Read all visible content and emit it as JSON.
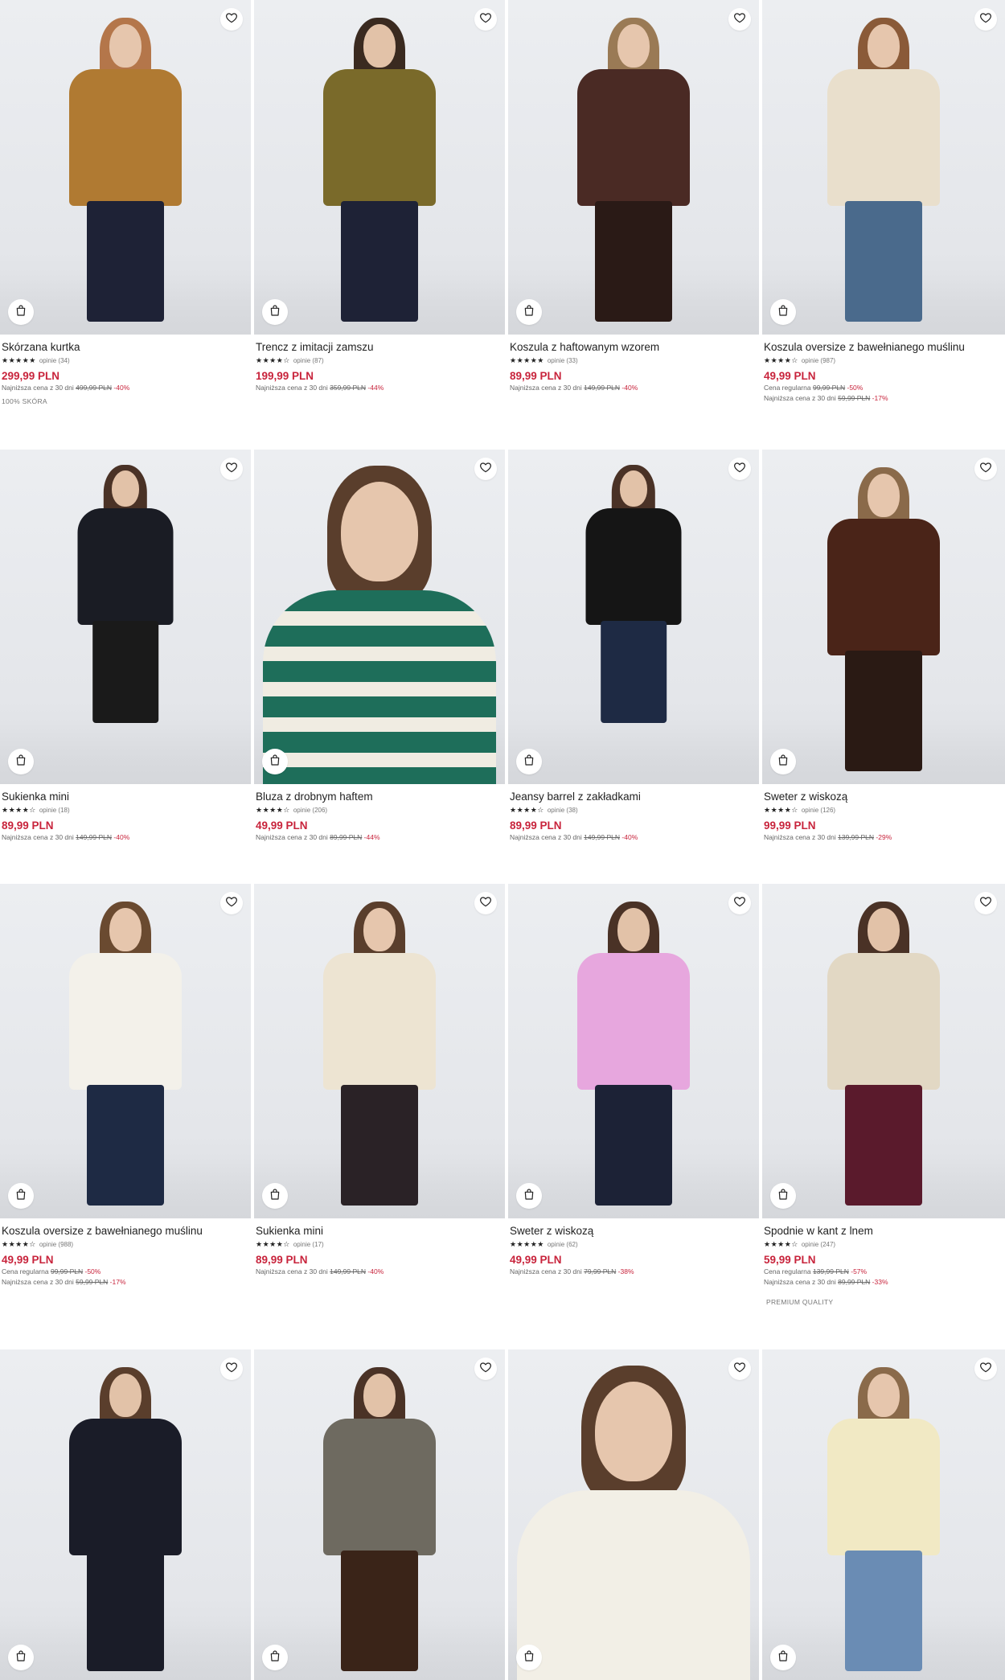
{
  "icons": {
    "wishlist": "heart-icon",
    "add_to_cart": "bag-icon"
  },
  "colors": {
    "price": "#c8243c",
    "text": "#222222",
    "muted": "#666666",
    "image_bg": "#e8eaed"
  },
  "products": [
    {
      "name": "Skórzana kurtka",
      "stars": "★★★★★",
      "reviews": "opinie (34)",
      "price": "299,99 PLN",
      "lines": [
        {
          "label": "Najniższa cena z 30 dni",
          "old": "499,99 PLN",
          "disc": "-40%"
        }
      ],
      "tag": "100% SKÓRA",
      "look": {
        "hair": "#b4764a",
        "top": "#b07a32",
        "bottom": "#1e2236",
        "skin": "#e6c6ad"
      }
    },
    {
      "name": "Trencz z imitacji zamszu",
      "stars": "★★★★☆",
      "reviews": "opinie (87)",
      "price": "199,99 PLN",
      "lines": [
        {
          "label": "Najniższa cena z 30 dni",
          "old": "359,99 PLN",
          "disc": "-44%"
        }
      ],
      "look": {
        "hair": "#3a2a20",
        "top": "#7a6a2a",
        "bottom": "#1e2236",
        "skin": "#e2c2a8"
      }
    },
    {
      "name": "Koszula z haftowanym wzorem",
      "stars": "★★★★★",
      "reviews": "opinie (33)",
      "price": "89,99 PLN",
      "lines": [
        {
          "label": "Najniższa cena z 30 dni",
          "old": "149,99 PLN",
          "disc": "-40%"
        }
      ],
      "look": {
        "hair": "#9a7a55",
        "top": "#4a2a24",
        "bottom": "#2a1a16",
        "skin": "#e6c6ad"
      }
    },
    {
      "name": "Koszula oversize z bawełnianego muślinu",
      "stars": "★★★★☆",
      "reviews": "opinie (987)",
      "price": "49,99 PLN",
      "lines": [
        {
          "label": "Cena regularna",
          "old": "99,99 PLN",
          "disc": "-50%"
        },
        {
          "label": "Najniższa cena z 30 dni",
          "old": "59,99 PLN",
          "disc": "-17%"
        }
      ],
      "look": {
        "hair": "#8a5a38",
        "top": "#e9dfcc",
        "bottom": "#4a6a8c",
        "skin": "#e6c6ad"
      }
    },
    {
      "name": "Sukienka mini",
      "stars": "★★★★☆",
      "reviews": "opinie (18)",
      "price": "89,99 PLN",
      "lines": [
        {
          "label": "Najniższa cena z 30 dni",
          "old": "149,99 PLN",
          "disc": "-40%"
        }
      ],
      "look": {
        "hair": "#4a3226",
        "top": "#1a1c24",
        "bottom": "#1a1a1a",
        "skin": "#e2c2a8"
      }
    },
    {
      "name": "Bluza z drobnym haftem",
      "stars": "★★★★☆",
      "reviews": "opinie (206)",
      "price": "49,99 PLN",
      "lines": [
        {
          "label": "Najniższa cena z 30 dni",
          "old": "89,99 PLN",
          "disc": "-44%"
        }
      ],
      "look": {
        "hair": "#5a3e2c",
        "top": "#1e6e5a",
        "bottom": "#f0ece2",
        "skin": "#e6c6ad"
      }
    },
    {
      "name": "Jeansy barrel z zakładkami",
      "stars": "★★★★☆",
      "reviews": "opinie (38)",
      "price": "89,99 PLN",
      "lines": [
        {
          "label": "Najniższa cena z 30 dni",
          "old": "149,99 PLN",
          "disc": "-40%"
        }
      ],
      "look": {
        "hair": "#4a3226",
        "top": "#151515",
        "bottom": "#1e2a44",
        "skin": "#e2c2a8"
      }
    },
    {
      "name": "Sweter z wiskozą",
      "stars": "★★★★☆",
      "reviews": "opinie (126)",
      "price": "99,99 PLN",
      "lines": [
        {
          "label": "Najniższa cena z 30 dni",
          "old": "139,99 PLN",
          "disc": "-29%"
        }
      ],
      "look": {
        "hair": "#8a6a4a",
        "top": "#4a2418",
        "bottom": "#2a1a14",
        "skin": "#e6c6ad"
      }
    },
    {
      "name": "Koszula oversize z bawełnianego muślinu",
      "stars": "★★★★☆",
      "reviews": "opinie (988)",
      "price": "49,99 PLN",
      "lines": [
        {
          "label": "Cena regularna",
          "old": "99,99 PLN",
          "disc": "-50%"
        },
        {
          "label": "Najniższa cena z 30 dni",
          "old": "59,99 PLN",
          "disc": "-17%"
        }
      ],
      "look": {
        "hair": "#6a4a30",
        "top": "#f3f1ea",
        "bottom": "#1e2a44",
        "skin": "#e6c6ad"
      }
    },
    {
      "name": "Sukienka mini",
      "stars": "★★★★☆",
      "reviews": "opinie (17)",
      "price": "89,99 PLN",
      "lines": [
        {
          "label": "Najniższa cena z 30 dni",
          "old": "149,99 PLN",
          "disc": "-40%"
        }
      ],
      "look": {
        "hair": "#5a3e2c",
        "top": "#ede4d2",
        "bottom": "#2a2226",
        "skin": "#e6c6ad"
      }
    },
    {
      "name": "Sweter z wiskozą",
      "stars": "★★★★★",
      "reviews": "opinie (62)",
      "price": "49,99 PLN",
      "lines": [
        {
          "label": "Najniższa cena z 30 dni",
          "old": "79,99 PLN",
          "disc": "-38%"
        }
      ],
      "look": {
        "hair": "#4a3226",
        "top": "#e7a7de",
        "bottom": "#1c2236",
        "skin": "#e2c2a8"
      }
    },
    {
      "name": "Spodnie w kant z lnem",
      "stars": "★★★★☆",
      "reviews": "opinie (247)",
      "price": "59,99 PLN",
      "lines": [
        {
          "label": "Cena regularna",
          "old": "139,99 PLN",
          "disc": "-57%"
        },
        {
          "label": "Najniższa cena z 30 dni",
          "old": "89,99 PLN",
          "disc": "-33%"
        }
      ],
      "tag": "PREMIUM QUALITY",
      "look": {
        "hair": "#4a3226",
        "top": "#e2d8c4",
        "bottom": "#5a1a2c",
        "skin": "#e2c2a8"
      }
    },
    {
      "look": {
        "hair": "#5a3e2c",
        "top": "#1a1c28",
        "bottom": "#1a1c28",
        "skin": "#e2c2a8"
      }
    },
    {
      "look": {
        "hair": "#4a3226",
        "top": "#6e6a60",
        "bottom": "#3a2418",
        "skin": "#e2c2a8"
      }
    },
    {
      "look": {
        "hair": "#5a3e2c",
        "top": "#f2efe6",
        "bottom": "#f2efe6",
        "skin": "#e6c6ad"
      }
    },
    {
      "look": {
        "hair": "#8a6a4a",
        "top": "#f1e9c4",
        "bottom": "#6a8cb4",
        "skin": "#e6c6ad"
      }
    }
  ]
}
